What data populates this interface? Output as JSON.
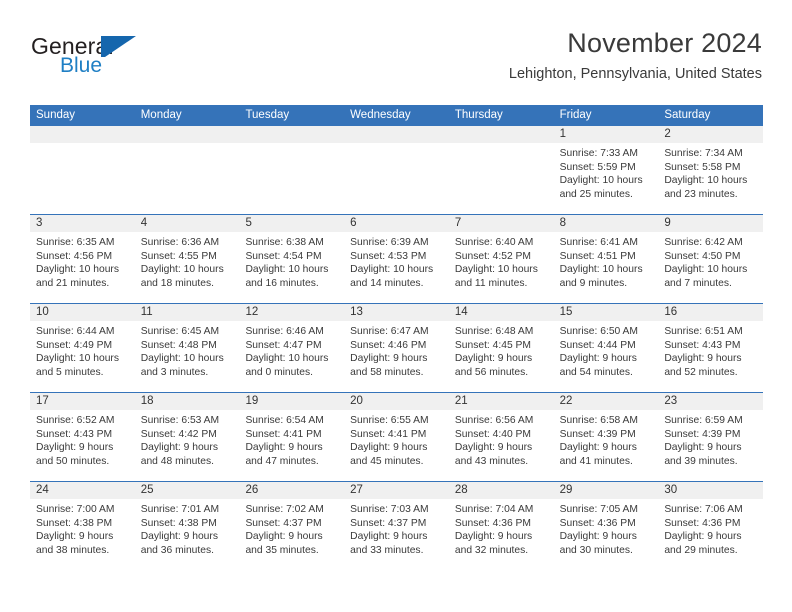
{
  "brand": {
    "name_part1": "General",
    "name_part2": "Blue"
  },
  "header": {
    "title": "November 2024",
    "subtitle": "Lehighton, Pennsylvania, United States",
    "accent_color": "#3573b9",
    "logo_color": "#1566ad"
  },
  "calendar": {
    "weekdays": [
      "Sunday",
      "Monday",
      "Tuesday",
      "Wednesday",
      "Thursday",
      "Friday",
      "Saturday"
    ],
    "weeks": [
      [
        {
          "day": "",
          "sunrise": "",
          "sunset": "",
          "daylight": "",
          "daylight2": ""
        },
        {
          "day": "",
          "sunrise": "",
          "sunset": "",
          "daylight": "",
          "daylight2": ""
        },
        {
          "day": "",
          "sunrise": "",
          "sunset": "",
          "daylight": "",
          "daylight2": ""
        },
        {
          "day": "",
          "sunrise": "",
          "sunset": "",
          "daylight": "",
          "daylight2": ""
        },
        {
          "day": "",
          "sunrise": "",
          "sunset": "",
          "daylight": "",
          "daylight2": ""
        },
        {
          "day": "1",
          "sunrise": "Sunrise: 7:33 AM",
          "sunset": "Sunset: 5:59 PM",
          "daylight": "Daylight: 10 hours",
          "daylight2": "and 25 minutes."
        },
        {
          "day": "2",
          "sunrise": "Sunrise: 7:34 AM",
          "sunset": "Sunset: 5:58 PM",
          "daylight": "Daylight: 10 hours",
          "daylight2": "and 23 minutes."
        }
      ],
      [
        {
          "day": "3",
          "sunrise": "Sunrise: 6:35 AM",
          "sunset": "Sunset: 4:56 PM",
          "daylight": "Daylight: 10 hours",
          "daylight2": "and 21 minutes."
        },
        {
          "day": "4",
          "sunrise": "Sunrise: 6:36 AM",
          "sunset": "Sunset: 4:55 PM",
          "daylight": "Daylight: 10 hours",
          "daylight2": "and 18 minutes."
        },
        {
          "day": "5",
          "sunrise": "Sunrise: 6:38 AM",
          "sunset": "Sunset: 4:54 PM",
          "daylight": "Daylight: 10 hours",
          "daylight2": "and 16 minutes."
        },
        {
          "day": "6",
          "sunrise": "Sunrise: 6:39 AM",
          "sunset": "Sunset: 4:53 PM",
          "daylight": "Daylight: 10 hours",
          "daylight2": "and 14 minutes."
        },
        {
          "day": "7",
          "sunrise": "Sunrise: 6:40 AM",
          "sunset": "Sunset: 4:52 PM",
          "daylight": "Daylight: 10 hours",
          "daylight2": "and 11 minutes."
        },
        {
          "day": "8",
          "sunrise": "Sunrise: 6:41 AM",
          "sunset": "Sunset: 4:51 PM",
          "daylight": "Daylight: 10 hours",
          "daylight2": "and 9 minutes."
        },
        {
          "day": "9",
          "sunrise": "Sunrise: 6:42 AM",
          "sunset": "Sunset: 4:50 PM",
          "daylight": "Daylight: 10 hours",
          "daylight2": "and 7 minutes."
        }
      ],
      [
        {
          "day": "10",
          "sunrise": "Sunrise: 6:44 AM",
          "sunset": "Sunset: 4:49 PM",
          "daylight": "Daylight: 10 hours",
          "daylight2": "and 5 minutes."
        },
        {
          "day": "11",
          "sunrise": "Sunrise: 6:45 AM",
          "sunset": "Sunset: 4:48 PM",
          "daylight": "Daylight: 10 hours",
          "daylight2": "and 3 minutes."
        },
        {
          "day": "12",
          "sunrise": "Sunrise: 6:46 AM",
          "sunset": "Sunset: 4:47 PM",
          "daylight": "Daylight: 10 hours",
          "daylight2": "and 0 minutes."
        },
        {
          "day": "13",
          "sunrise": "Sunrise: 6:47 AM",
          "sunset": "Sunset: 4:46 PM",
          "daylight": "Daylight: 9 hours",
          "daylight2": "and 58 minutes."
        },
        {
          "day": "14",
          "sunrise": "Sunrise: 6:48 AM",
          "sunset": "Sunset: 4:45 PM",
          "daylight": "Daylight: 9 hours",
          "daylight2": "and 56 minutes."
        },
        {
          "day": "15",
          "sunrise": "Sunrise: 6:50 AM",
          "sunset": "Sunset: 4:44 PM",
          "daylight": "Daylight: 9 hours",
          "daylight2": "and 54 minutes."
        },
        {
          "day": "16",
          "sunrise": "Sunrise: 6:51 AM",
          "sunset": "Sunset: 4:43 PM",
          "daylight": "Daylight: 9 hours",
          "daylight2": "and 52 minutes."
        }
      ],
      [
        {
          "day": "17",
          "sunrise": "Sunrise: 6:52 AM",
          "sunset": "Sunset: 4:43 PM",
          "daylight": "Daylight: 9 hours",
          "daylight2": "and 50 minutes."
        },
        {
          "day": "18",
          "sunrise": "Sunrise: 6:53 AM",
          "sunset": "Sunset: 4:42 PM",
          "daylight": "Daylight: 9 hours",
          "daylight2": "and 48 minutes."
        },
        {
          "day": "19",
          "sunrise": "Sunrise: 6:54 AM",
          "sunset": "Sunset: 4:41 PM",
          "daylight": "Daylight: 9 hours",
          "daylight2": "and 47 minutes."
        },
        {
          "day": "20",
          "sunrise": "Sunrise: 6:55 AM",
          "sunset": "Sunset: 4:41 PM",
          "daylight": "Daylight: 9 hours",
          "daylight2": "and 45 minutes."
        },
        {
          "day": "21",
          "sunrise": "Sunrise: 6:56 AM",
          "sunset": "Sunset: 4:40 PM",
          "daylight": "Daylight: 9 hours",
          "daylight2": "and 43 minutes."
        },
        {
          "day": "22",
          "sunrise": "Sunrise: 6:58 AM",
          "sunset": "Sunset: 4:39 PM",
          "daylight": "Daylight: 9 hours",
          "daylight2": "and 41 minutes."
        },
        {
          "day": "23",
          "sunrise": "Sunrise: 6:59 AM",
          "sunset": "Sunset: 4:39 PM",
          "daylight": "Daylight: 9 hours",
          "daylight2": "and 39 minutes."
        }
      ],
      [
        {
          "day": "24",
          "sunrise": "Sunrise: 7:00 AM",
          "sunset": "Sunset: 4:38 PM",
          "daylight": "Daylight: 9 hours",
          "daylight2": "and 38 minutes."
        },
        {
          "day": "25",
          "sunrise": "Sunrise: 7:01 AM",
          "sunset": "Sunset: 4:38 PM",
          "daylight": "Daylight: 9 hours",
          "daylight2": "and 36 minutes."
        },
        {
          "day": "26",
          "sunrise": "Sunrise: 7:02 AM",
          "sunset": "Sunset: 4:37 PM",
          "daylight": "Daylight: 9 hours",
          "daylight2": "and 35 minutes."
        },
        {
          "day": "27",
          "sunrise": "Sunrise: 7:03 AM",
          "sunset": "Sunset: 4:37 PM",
          "daylight": "Daylight: 9 hours",
          "daylight2": "and 33 minutes."
        },
        {
          "day": "28",
          "sunrise": "Sunrise: 7:04 AM",
          "sunset": "Sunset: 4:36 PM",
          "daylight": "Daylight: 9 hours",
          "daylight2": "and 32 minutes."
        },
        {
          "day": "29",
          "sunrise": "Sunrise: 7:05 AM",
          "sunset": "Sunset: 4:36 PM",
          "daylight": "Daylight: 9 hours",
          "daylight2": "and 30 minutes."
        },
        {
          "day": "30",
          "sunrise": "Sunrise: 7:06 AM",
          "sunset": "Sunset: 4:36 PM",
          "daylight": "Daylight: 9 hours",
          "daylight2": "and 29 minutes."
        }
      ]
    ]
  }
}
